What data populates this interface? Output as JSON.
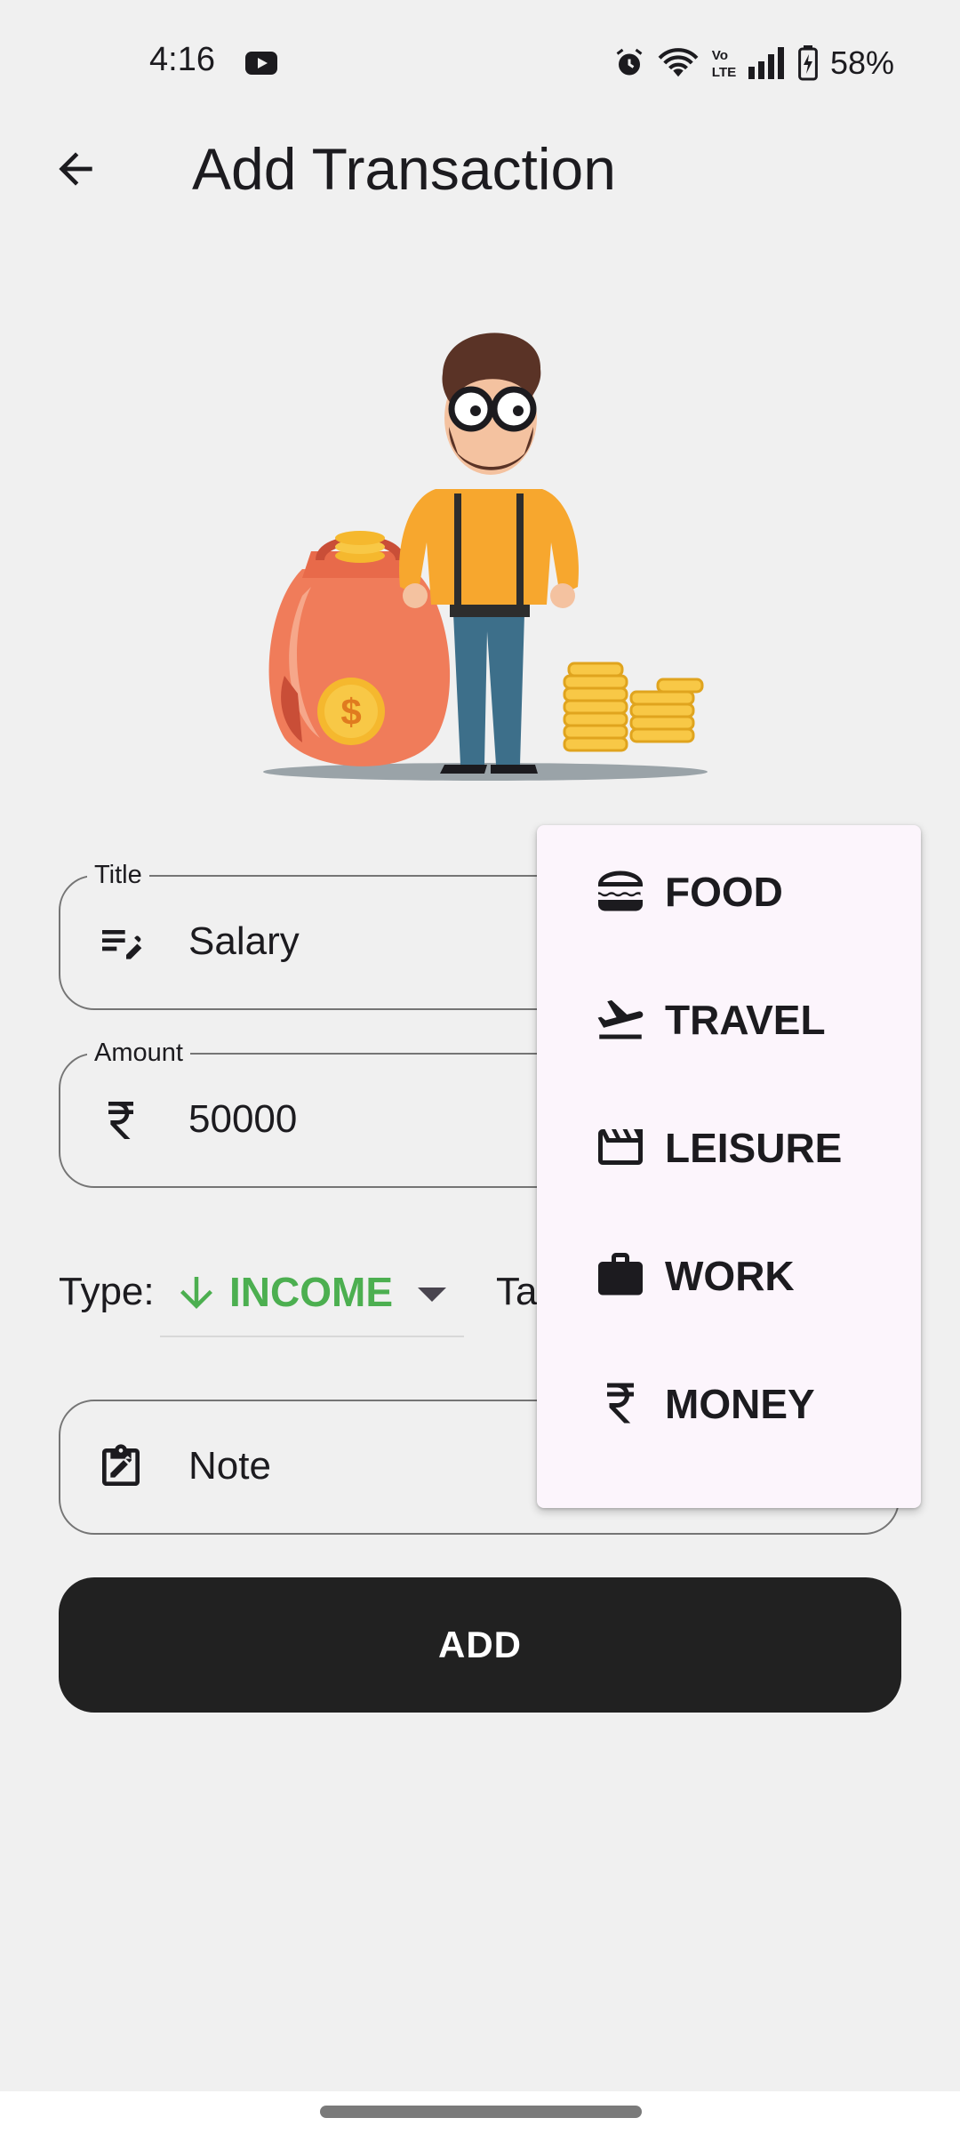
{
  "status_bar": {
    "time": "4:16",
    "battery": "58%",
    "icons": [
      "youtube-icon",
      "alarm-icon",
      "wifi-icon",
      "volte-icon",
      "signal-icon",
      "battery-charging-icon"
    ]
  },
  "app_bar": {
    "back_icon": "arrow-back-icon",
    "title": "Add Transaction"
  },
  "form": {
    "title_field": {
      "label": "Title",
      "value": "Salary",
      "icon": "edit-note-icon"
    },
    "amount_field": {
      "label": "Amount",
      "value": "50000",
      "icon": "rupee-icon"
    },
    "type": {
      "label": "Type:",
      "value": "INCOME",
      "icon": "arrow-downward-icon",
      "color": "#4caf50"
    },
    "tag": {
      "label": "Ta"
    },
    "note_field": {
      "placeholder": "Note",
      "icon": "edit-clipboard-icon"
    },
    "add_button": "ADD"
  },
  "tag_menu": {
    "items": [
      {
        "label": "FOOD",
        "icon": "burger-icon"
      },
      {
        "label": "TRAVEL",
        "icon": "flight-takeoff-icon"
      },
      {
        "label": "LEISURE",
        "icon": "movie-clapper-icon"
      },
      {
        "label": "WORK",
        "icon": "briefcase-icon"
      },
      {
        "label": "MONEY",
        "icon": "rupee-icon"
      }
    ]
  },
  "colors": {
    "background": "#f0f0f0",
    "button": "#212121",
    "income": "#4caf50",
    "menu_surface": "#fcf5fc"
  }
}
